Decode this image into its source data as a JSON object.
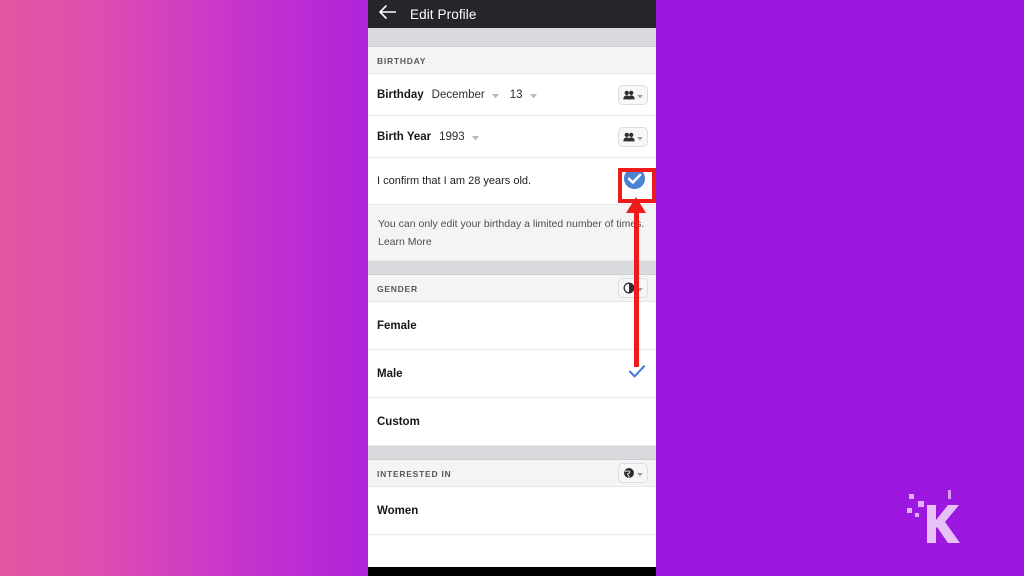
{
  "app": {
    "header": {
      "title": "Edit Profile",
      "back_icon": "back-arrow-icon"
    }
  },
  "colors": {
    "header_bg": "#26262a",
    "accent_blue": "#4a7cd6",
    "annotation_red": "#ee1b1b",
    "backdrop_pink": "#e3569f",
    "backdrop_purple": "#9c18e0",
    "section_bg": "#f4f4f5",
    "divider": "#d9dadd"
  },
  "sections": {
    "birthday": {
      "header": "BIRTHDAY",
      "privacy_icon": "friends-icon",
      "privacy_chevron": "chevron-down-icon",
      "fields": [
        {
          "label": "Birthday",
          "values": [
            {
              "text": "December",
              "chevron": "chevron-down-icon"
            },
            {
              "text": "13",
              "chevron": "chevron-down-icon"
            }
          ]
        },
        {
          "label": "Birth Year",
          "values": [
            {
              "text": "1993",
              "chevron": "chevron-down-icon"
            }
          ]
        }
      ],
      "confirm": {
        "text": "I confirm that I am 28 years old.",
        "checked": true,
        "check_icon": "check-circle-icon"
      },
      "note": "You can only edit your birthday a limited number of times. Learn More",
      "note_link": "Learn More"
    },
    "gender": {
      "header": "GENDER",
      "privacy_icon": "only-me-icon",
      "privacy_chevron": "chevron-down-icon",
      "options": [
        {
          "label": "Female",
          "selected": false
        },
        {
          "label": "Male",
          "selected": true
        },
        {
          "label": "Custom",
          "selected": false
        }
      ]
    },
    "interested_in": {
      "header": "INTERESTED IN",
      "privacy_icon": "public-globe-icon",
      "privacy_chevron": "chevron-down-icon",
      "options": [
        {
          "label": "Women",
          "selected": false
        }
      ]
    }
  },
  "annotation": {
    "highlight_target": "confirm-age-checkbox",
    "arrow": "red-up-arrow"
  },
  "watermark": {
    "label": "K"
  }
}
